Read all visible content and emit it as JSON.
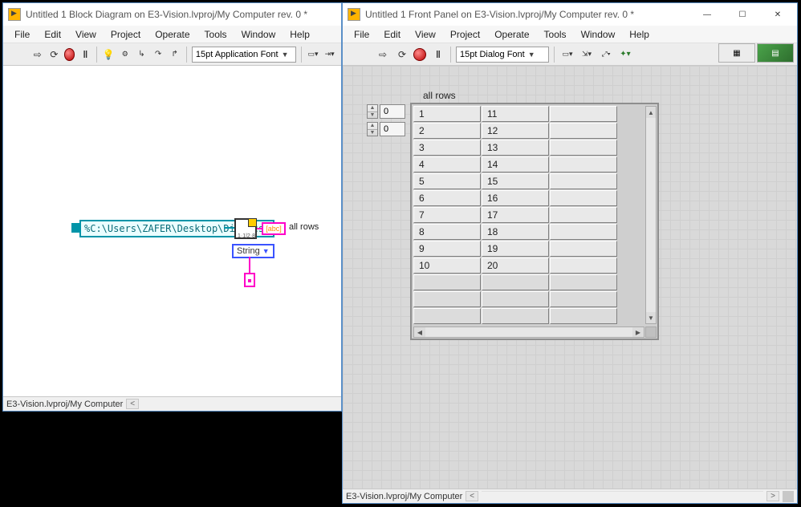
{
  "bd": {
    "title": "Untitled 1 Block Diagram on E3-Vision.lvproj/My Computer rev. 0 *",
    "menu": [
      "File",
      "Edit",
      "View",
      "Project",
      "Operate",
      "Tools",
      "Window",
      "Help"
    ],
    "font": "15pt Application Font",
    "path_constant": "%C:\\Users\\ZAFER\\Desktop\\Dizi.csv",
    "read_node_subtext": "1·1|2·8|",
    "string_poly": "String",
    "indicator_glyph": "[abc]",
    "indicator_label": "all rows",
    "status": "E3-Vision.lvproj/My Computer"
  },
  "fp": {
    "title": "Untitled 1 Front Panel on E3-Vision.lvproj/My Computer rev. 0 *",
    "menu": [
      "File",
      "Edit",
      "View",
      "Project",
      "Operate",
      "Tools",
      "Window",
      "Help"
    ],
    "font": "15pt Dialog Font",
    "array_label": "all rows",
    "idx0": "0",
    "idx1": "0",
    "rows": [
      [
        "1",
        "11",
        ""
      ],
      [
        "2",
        "12",
        ""
      ],
      [
        "3",
        "13",
        ""
      ],
      [
        "4",
        "14",
        ""
      ],
      [
        "5",
        "15",
        ""
      ],
      [
        "6",
        "16",
        ""
      ],
      [
        "7",
        "17",
        ""
      ],
      [
        "8",
        "18",
        ""
      ],
      [
        "9",
        "19",
        ""
      ],
      [
        "10",
        "20",
        ""
      ]
    ],
    "empty_rows": 3,
    "status": "E3-Vision.lvproj/My Computer"
  },
  "winbtn": {
    "min": "—",
    "max": "☐",
    "close": "✕"
  }
}
